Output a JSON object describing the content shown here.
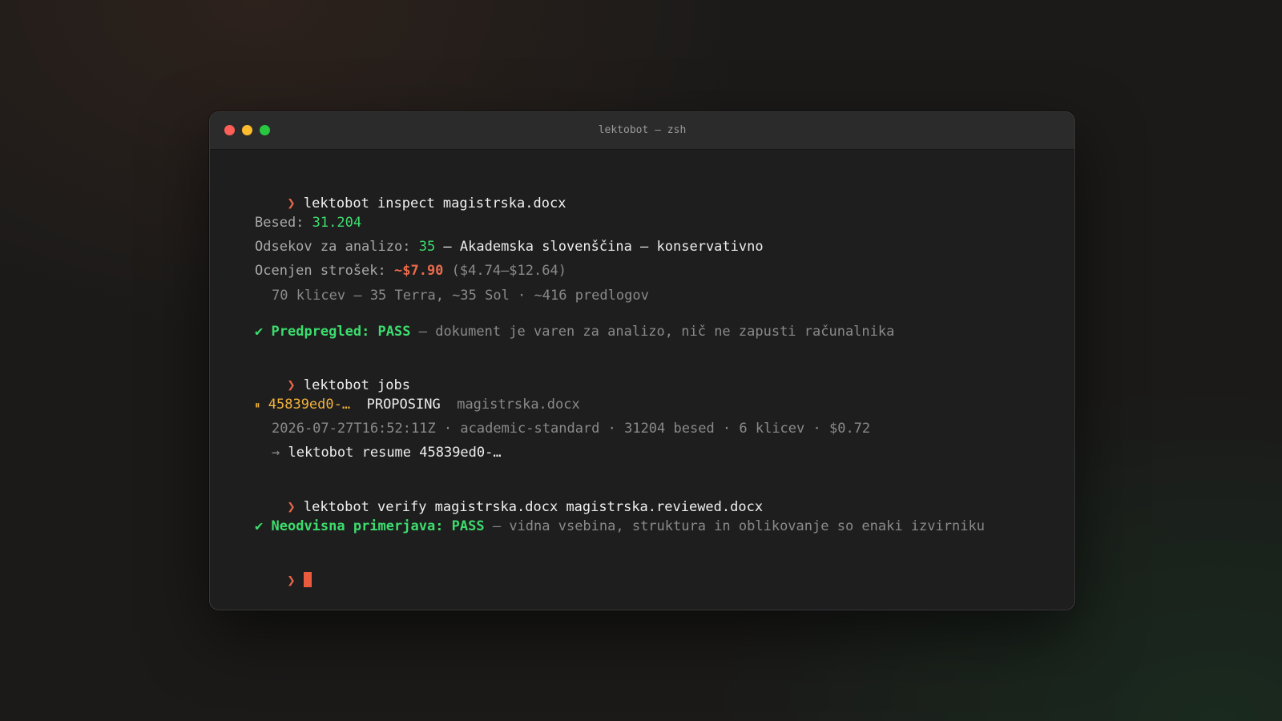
{
  "window": {
    "title": "lektobot — zsh",
    "colors": {
      "red": "#ff5f57",
      "yellow": "#febc2e",
      "green": "#28c840"
    }
  },
  "prompt_symbol": "❯",
  "session": {
    "cmd1": "lektobot inspect magistrska.docx",
    "words_label": "Besed: ",
    "words_value": "31.204",
    "sections_label": "Odsekov za analizo: ",
    "sections_value": "35",
    "sections_rest": " — Akademska slovenščina — konservativno",
    "cost_label": "Ocenjen strošek: ",
    "cost_value": "~$7.90",
    "cost_range": " ($4.74–$12.64)",
    "calls_detail": "70 klicev — 35 Terra, ~35 Sol · ~416 predlogov",
    "check_mark": "✔",
    "precheck_label": "Predpregled: PASS",
    "precheck_rest": " — dokument je varen za analizo, nič ne zapusti računalnika",
    "cmd2": "lektobot jobs",
    "pause_icon": "⏸",
    "job_id": "45839ed0-…",
    "job_status": "PROPOSING",
    "job_file": "magistrska.docx",
    "job_meta": "2026-07-27T16:52:11Z · academic-standard · 31204 besed · 6 klicev · $0.72",
    "arrow": "→",
    "resume_cmd": "lektobot resume 45839ed0-…",
    "cmd3": "lektobot verify magistrska.docx magistrska.reviewed.docx",
    "verify_label": "Neodvisna primerjava: PASS",
    "verify_rest": " — vidna vsebina, struktura in oblikovanje so enaki izvirniku"
  },
  "colors": {
    "prompt": "#e8674a",
    "success": "#3ddc6e",
    "warning": "#f2b33d",
    "cost": "#ea6b4c"
  }
}
